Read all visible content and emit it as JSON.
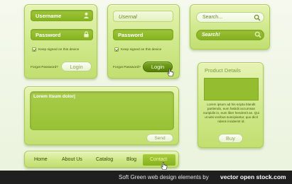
{
  "login_panel_default": {
    "username_label": "Username",
    "password_label": "Password",
    "keep_signed_in": "Keep signed on this device",
    "forgot_password": "Forgot Password?",
    "login_button": "Login",
    "keep_signed_checked": true
  },
  "login_panel_active": {
    "username_placeholder": "Usernal",
    "password_label": "Password",
    "keep_signed_in": "Keep signed on this device",
    "forgot_password": "Forgot Password?",
    "login_button": "Login",
    "keep_signed_checked": true
  },
  "search_panel": {
    "search_default": "Search...",
    "search_active": "Search!"
  },
  "product_panel": {
    "title": "Product Details",
    "description": "Lorem ipsum ad his scipta blandit partiendo, eum fastidii accumsan euripidis in, eum liber hendrerit an. Qui ut wisi vocibus suscipiantur, quo dicit ridens inciderint id.",
    "buy_button": "Buy"
  },
  "message_panel": {
    "textarea_text": "Lorem itsum dolor|",
    "send_button": "Send"
  },
  "nav_bar": {
    "items": [
      "Home",
      "About Us",
      "Catalog",
      "Blog",
      "Contact"
    ],
    "active_index": 4
  },
  "footer": {
    "caption": "Soft Green web design elements by",
    "brand": "vector open stock.com"
  },
  "colors": {
    "panel_light": "#e6f3b4",
    "panel_green": "#c2df70",
    "accent_dark": "#557f08",
    "field_dark": "#84b21f",
    "footer_bg": "#1f1f1f"
  }
}
